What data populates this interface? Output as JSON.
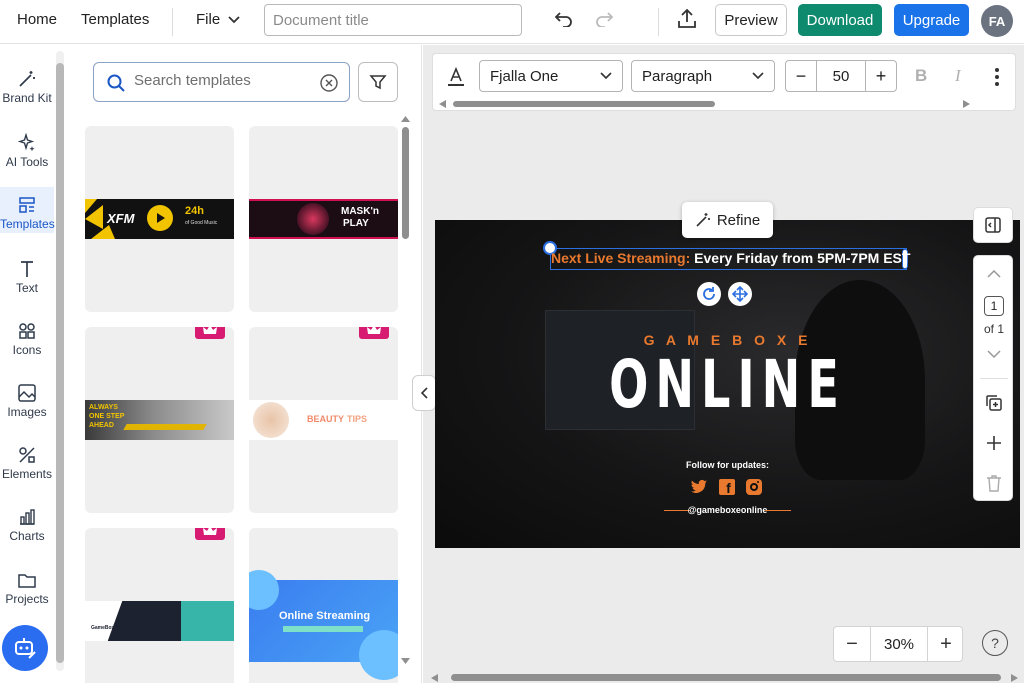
{
  "topbar": {
    "home": "Home",
    "templates": "Templates",
    "file": "File",
    "doc_title_placeholder": "Document title",
    "preview": "Preview",
    "download": "Download",
    "upgrade": "Upgrade",
    "avatar_initials": "FA"
  },
  "rail": {
    "items": [
      {
        "label": "Brand Kit",
        "icon": "magic-wand-icon"
      },
      {
        "label": "AI Tools",
        "icon": "sparkles-icon"
      },
      {
        "label": "Templates",
        "icon": "templates-icon"
      },
      {
        "label": "Text",
        "icon": "text-icon"
      },
      {
        "label": "Icons",
        "icon": "shapes-icon"
      },
      {
        "label": "Images",
        "icon": "image-icon"
      },
      {
        "label": "Elements",
        "icon": "elements-icon"
      },
      {
        "label": "Charts",
        "icon": "bar-chart-icon"
      },
      {
        "label": "Projects",
        "icon": "folder-icon"
      }
    ]
  },
  "panel": {
    "search_placeholder": "Search templates",
    "cards": [
      {
        "brand": "XFM",
        "time": "24h",
        "sub": "of Good Music"
      },
      {
        "title": "MASK'n",
        "title2": "PLAY"
      },
      {
        "line1": "ALWAYS",
        "line2": "ONE STEP",
        "line3": "AHEAD",
        "premium": true
      },
      {
        "title": "BEAUTY",
        "accent": "TIPS",
        "premium": true
      },
      {
        "brand": "GameBox",
        "premium": true
      },
      {
        "title": "Online Streaming"
      }
    ]
  },
  "toolbar": {
    "font": "Fjalla One",
    "style": "Paragraph",
    "size": "50",
    "bold": "B",
    "italic": "I"
  },
  "design": {
    "headline_accent": "Next Live Streaming:",
    "headline": " Every Friday from 5PM-7PM EST",
    "brand_spaced": "G A M E B O X E",
    "main": "ONLINE",
    "follow": "Follow for updates:",
    "handle": "@gameboxeonline",
    "colors": {
      "accent": "#e8792e",
      "background": "#111111",
      "text": "#ffffff"
    }
  },
  "refine": "Refine",
  "pages": {
    "current": "1",
    "of": "of 1"
  },
  "zoom": {
    "value": "30%"
  },
  "help": "?"
}
